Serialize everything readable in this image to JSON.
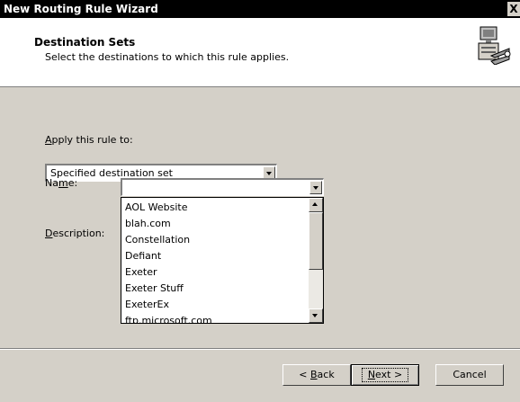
{
  "window": {
    "title": "New Routing Rule Wizard",
    "close_label": "X"
  },
  "header": {
    "title": "Destination Sets",
    "subtitle": "Select the destinations to which this rule applies.",
    "icon": "routing-computer-icon"
  },
  "form": {
    "apply_label_mnemonic": "A",
    "apply_label_rest": "pply this rule to:",
    "apply_value": "Specified destination set",
    "name_label_pre": "Na",
    "name_label_mnemonic": "m",
    "name_label_post": "e:",
    "name_value": "",
    "description_label_mnemonic": "D",
    "description_label_rest": "escription:"
  },
  "dropdown_list": {
    "items": [
      "AOL Website",
      "blah.com",
      "Constellation",
      "Defiant",
      "Exeter",
      "Exeter Stuff",
      "ExeterEx",
      "ftp.microsoft.com"
    ]
  },
  "buttons": {
    "back_pre": "< ",
    "back_mnemonic": "B",
    "back_post": "ack",
    "next_mnemonic": "N",
    "next_post": "ext >",
    "cancel": "Cancel"
  }
}
